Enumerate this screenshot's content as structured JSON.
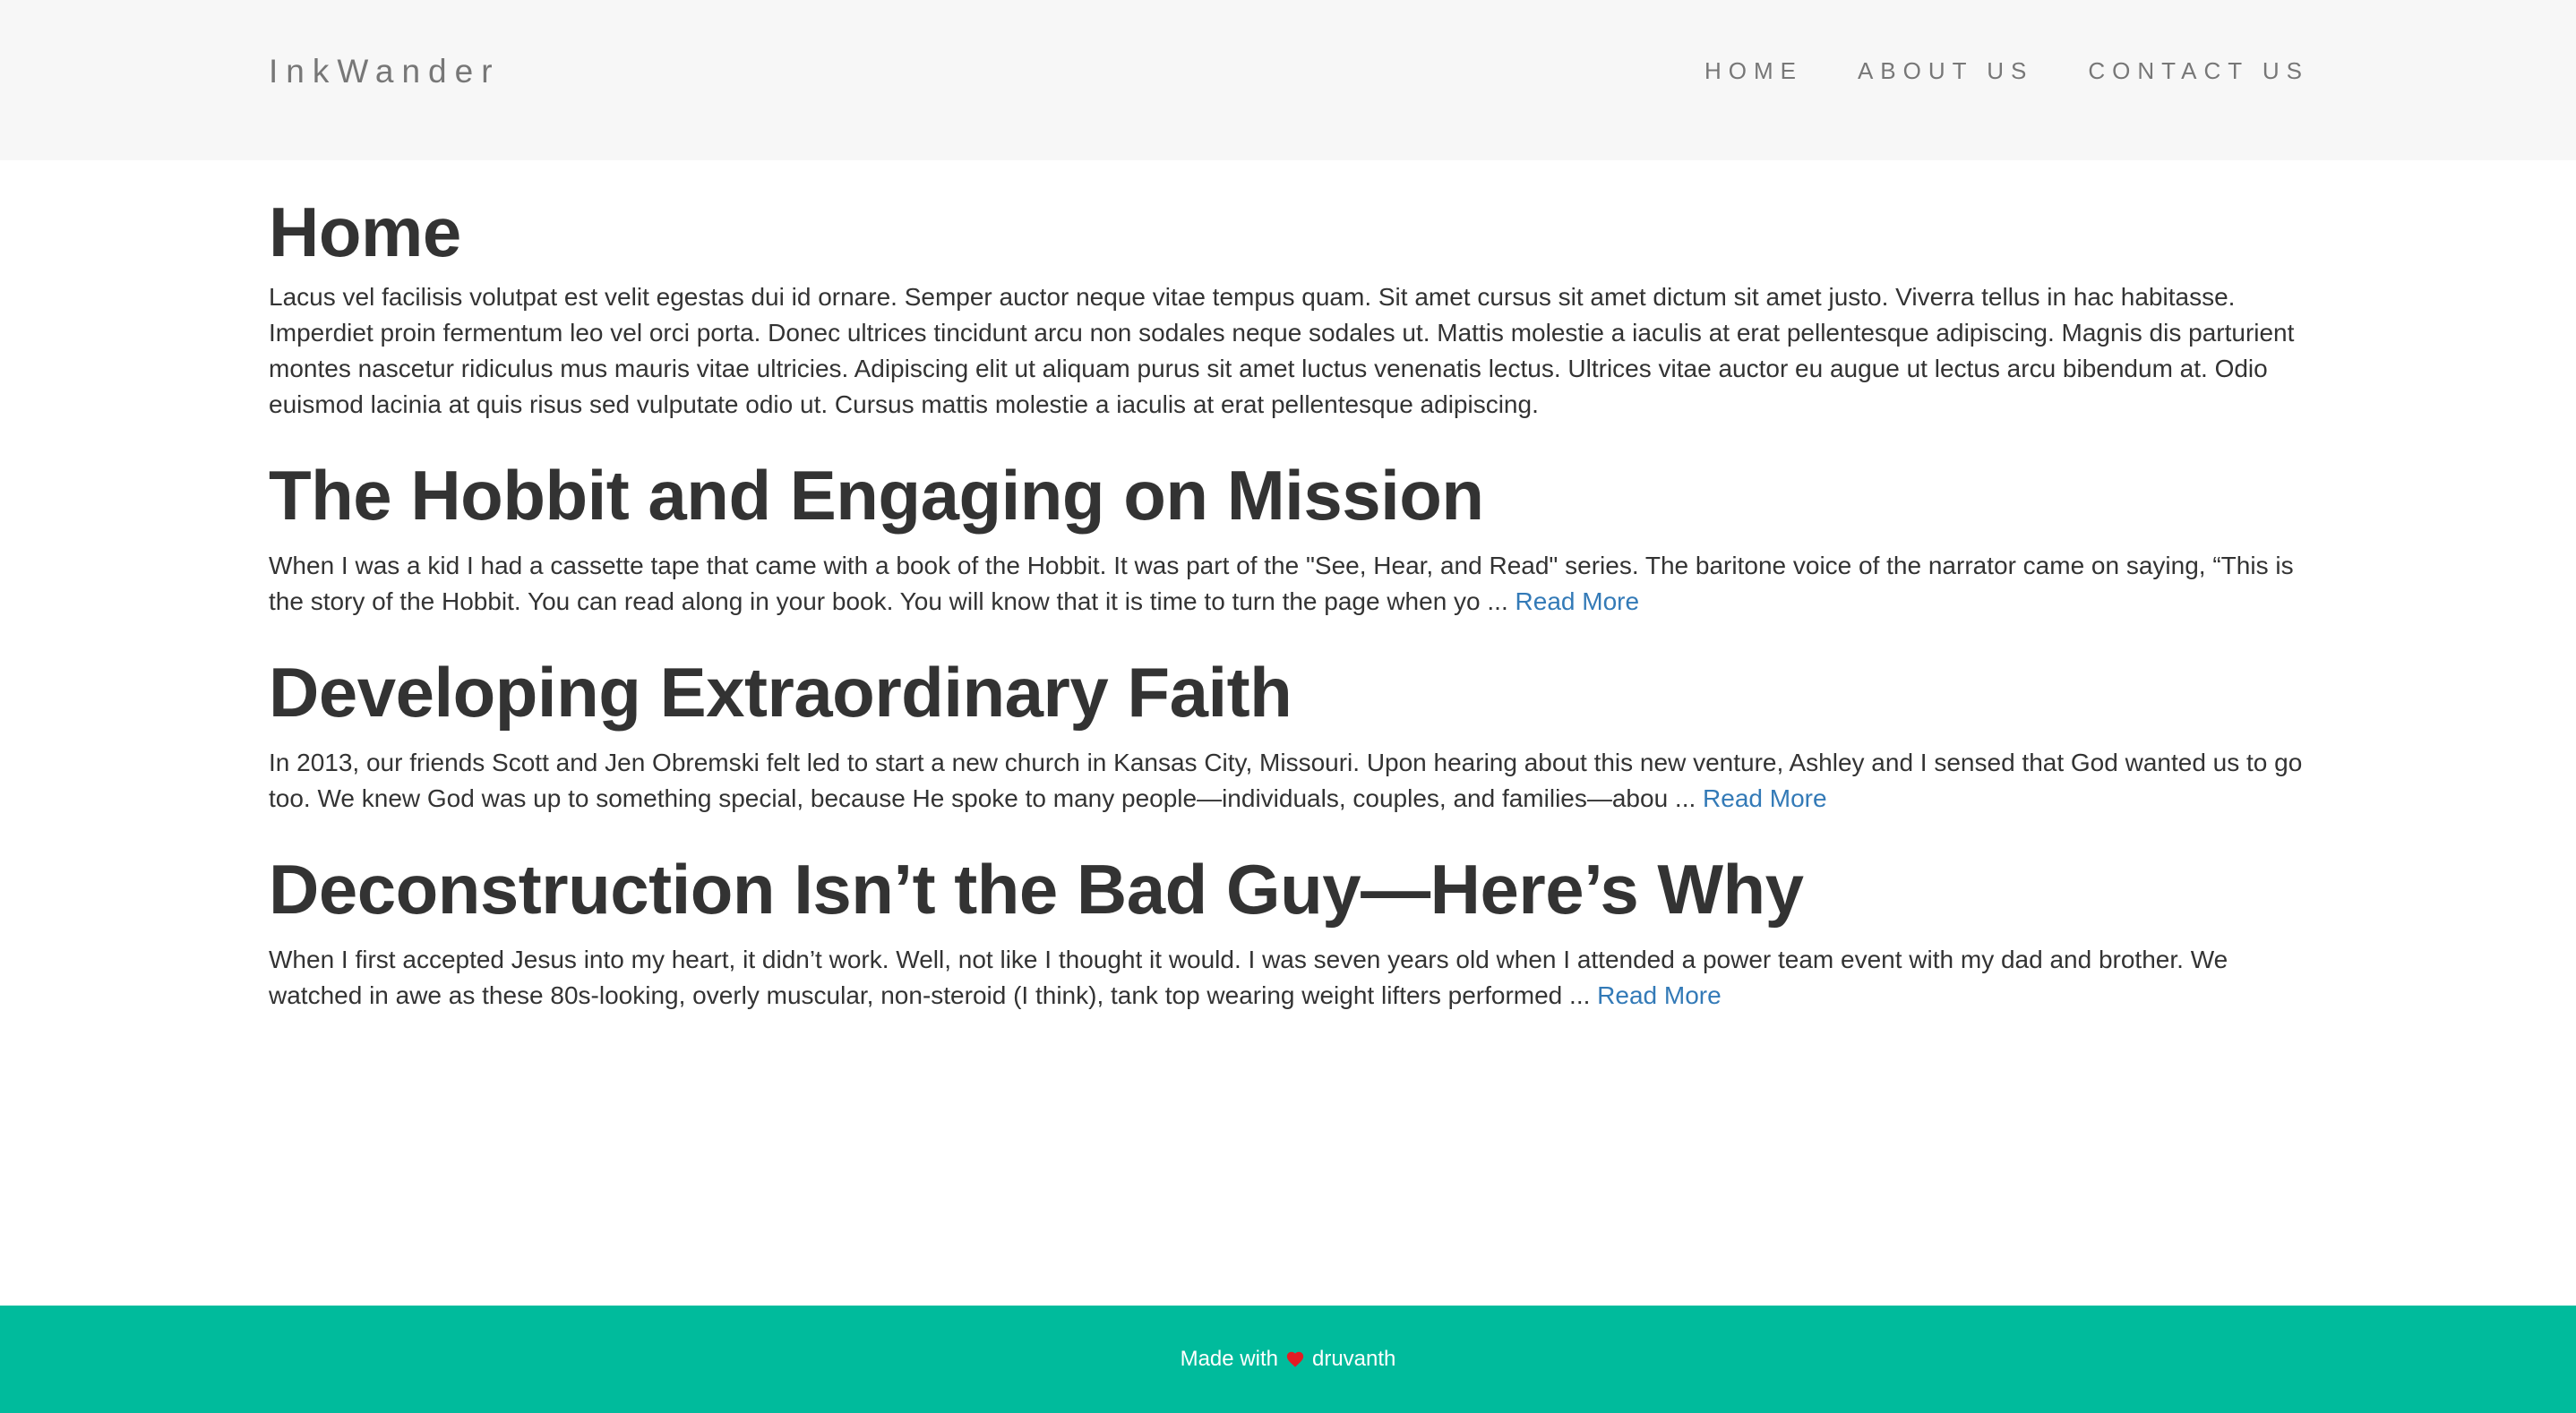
{
  "header": {
    "brand": "InkWander",
    "nav": [
      {
        "label": "HOME"
      },
      {
        "label": "ABOUT US"
      },
      {
        "label": "CONTACT US"
      }
    ]
  },
  "main": {
    "title": "Home",
    "intro": "Lacus vel facilisis volutpat est velit egestas dui id ornare. Semper auctor neque vitae tempus quam. Sit amet cursus sit amet dictum sit amet justo. Viverra tellus in hac habitasse. Imperdiet proin fermentum leo vel orci porta. Donec ultrices tincidunt arcu non sodales neque sodales ut. Mattis molestie a iaculis at erat pellentesque adipiscing. Magnis dis parturient montes nascetur ridiculus mus mauris vitae ultricies. Adipiscing elit ut aliquam purus sit amet luctus venenatis lectus. Ultrices vitae auctor eu augue ut lectus arcu bibendum at. Odio euismod lacinia at quis risus sed vulputate odio ut. Cursus mattis molestie a iaculis at erat pellentesque adipiscing.",
    "posts": [
      {
        "title": "The Hobbit and Engaging on Mission",
        "excerpt": "When I was a kid I had a cassette tape that came with a book of the Hobbit. It was part of the \"See, Hear, and Read\" series. The baritone voice of the narrator came on saying, “This is the story of the Hobbit. You can read along in your book. You will know that it is time to turn the page when yo ... ",
        "read_more": "Read More"
      },
      {
        "title": "Developing Extraordinary Faith",
        "excerpt": "In 2013, our friends Scott and Jen Obremski felt led to start a new church in Kansas City, Missouri. Upon hearing about this new venture, Ashley and I sensed that God wanted us to go too. We knew God was up to something special, because He spoke to many people—individuals, couples, and families—abou ... ",
        "read_more": "Read More"
      },
      {
        "title": "Deconstruction Isn’t the Bad Guy—Here’s Why",
        "excerpt": "When I first accepted Jesus into my heart, it didn’t work. Well, not like I thought it would. I was seven years old when I attended a power team event with my dad and brother. We watched in awe as these 80s-looking, overly muscular, non-steroid (I think), tank top wearing weight lifters performed ... ",
        "read_more": "Read More"
      }
    ]
  },
  "footer": {
    "prefix": "Made with",
    "icon": "heart-icon",
    "author": "druvanth"
  },
  "colors": {
    "navbar_bg": "#f7f7f7",
    "footer_bg": "#00bb9c",
    "link": "#337ab7",
    "text": "#333333",
    "nav_text": "#777777",
    "heart": "#e31b23"
  }
}
